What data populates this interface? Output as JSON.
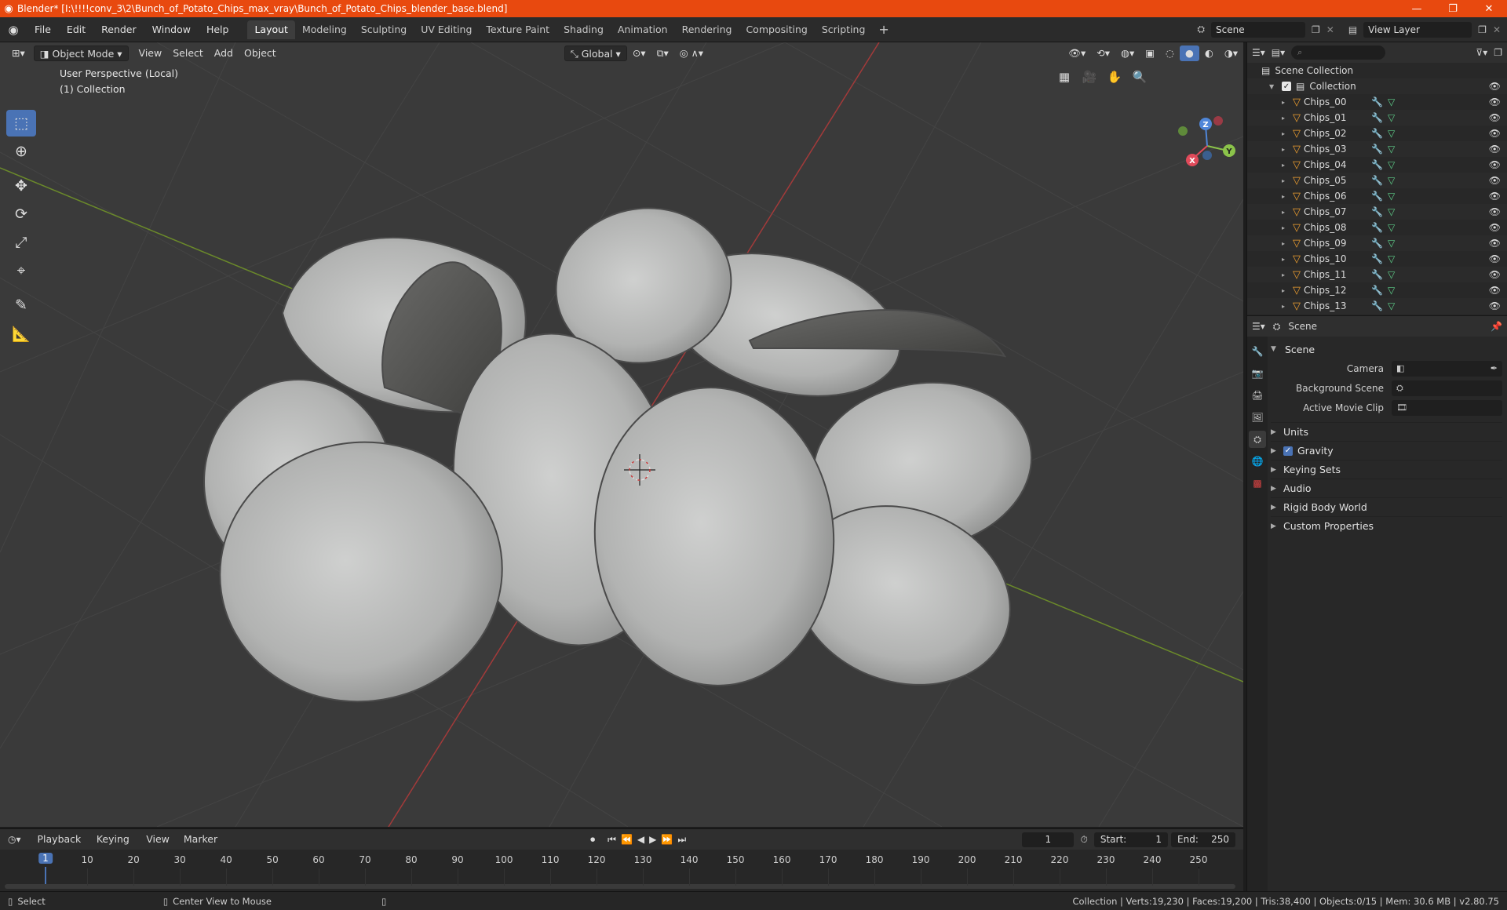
{
  "window": {
    "title": "Blender* [I:\\!!!!conv_3\\2\\Bunch_of_Potato_Chips_max_vray\\Bunch_of_Potato_Chips_blender_base.blend]",
    "minimize": "—",
    "maximize": "❐",
    "close": "✕"
  },
  "menubar": {
    "items": [
      "File",
      "Edit",
      "Render",
      "Window",
      "Help"
    ],
    "workspaces": [
      "Layout",
      "Modeling",
      "Sculpting",
      "UV Editing",
      "Texture Paint",
      "Shading",
      "Animation",
      "Rendering",
      "Compositing",
      "Scripting"
    ],
    "active_workspace": "Layout",
    "scene": "Scene",
    "view_layer": "View Layer"
  },
  "viewport": {
    "mode": "Object Mode",
    "menus": [
      "View",
      "Select",
      "Add",
      "Object"
    ],
    "orientation": "Global",
    "info_line1": "User Perspective (Local)",
    "info_line2": "(1) Collection",
    "axes": {
      "x": "X",
      "y": "Y",
      "z": "Z"
    }
  },
  "outliner": {
    "search_placeholder": "",
    "root": "Scene Collection",
    "collection": "Collection",
    "objects": [
      "Chips_00",
      "Chips_01",
      "Chips_02",
      "Chips_03",
      "Chips_04",
      "Chips_05",
      "Chips_06",
      "Chips_07",
      "Chips_08",
      "Chips_09",
      "Chips_10",
      "Chips_11",
      "Chips_12",
      "Chips_13"
    ]
  },
  "properties": {
    "header": "Scene",
    "panel": "Scene",
    "fields": {
      "camera": "Camera",
      "background_scene": "Background Scene",
      "active_movie_clip": "Active Movie Clip"
    },
    "subpanels": {
      "units": "Units",
      "gravity": "Gravity",
      "keying_sets": "Keying Sets",
      "audio": "Audio",
      "rigid_body_world": "Rigid Body World",
      "custom_properties": "Custom Properties"
    }
  },
  "timeline": {
    "menus": [
      "Playback",
      "Keying",
      "View",
      "Marker"
    ],
    "current_frame": "1",
    "start_label": "Start:",
    "start": "1",
    "end_label": "End:",
    "end": "250",
    "ticks": [
      "10",
      "20",
      "30",
      "40",
      "50",
      "60",
      "70",
      "80",
      "90",
      "100",
      "110",
      "120",
      "130",
      "140",
      "150",
      "160",
      "170",
      "180",
      "190",
      "200",
      "210",
      "220",
      "230",
      "240",
      "250"
    ]
  },
  "statusbar": {
    "select": "Select",
    "center": "Center View to Mouse",
    "stats": "Collection | Verts:19,230 | Faces:19,200 | Tris:38,400 | Objects:0/15 | Mem: 30.6 MB | v2.80.75"
  }
}
